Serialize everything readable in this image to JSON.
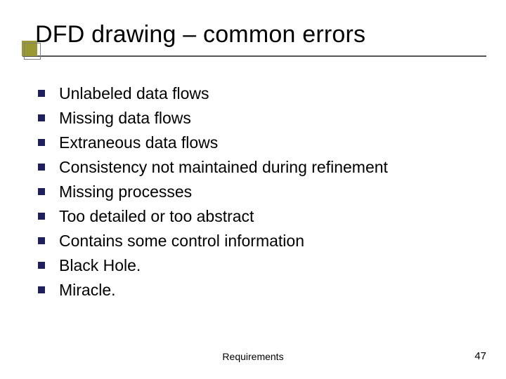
{
  "title": "DFD drawing – common errors",
  "bullets": [
    "Unlabeled data flows",
    "Missing data flows",
    "Extraneous data flows",
    "Consistency not maintained during refinement",
    "Missing processes",
    "Too detailed or too abstract",
    "Contains some control information",
    "Black Hole.",
    "Miracle."
  ],
  "footer": {
    "center": "Requirements",
    "page": "47"
  },
  "colors": {
    "title_accent": "#999933",
    "bullet": "#1f1f5c",
    "rule": "#555555"
  }
}
